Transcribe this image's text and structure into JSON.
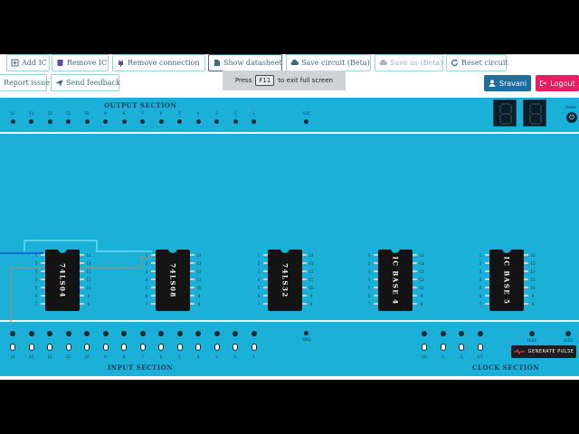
{
  "toolbar": {
    "add_ic": "Add IC",
    "remove_ic": "Remove IC",
    "remove_connection": "Remove connection",
    "show_datasheet": "Show datasheet",
    "save_circuit": "Save circuit (Beta)",
    "save_as": "Save as (Beta)",
    "reset_circuit": "Reset circuit",
    "report_issue": "Report issue",
    "send_feedback": "Send feedback"
  },
  "user": {
    "name": "Sravani",
    "logout": "Logout"
  },
  "toast": {
    "before": "Press",
    "key": "F11",
    "after": "to exit full screen"
  },
  "board": {
    "output_section": "OUTPUT SECTION",
    "input_section": "INPUT SECTION",
    "clock_section": "CLOCK SECTION",
    "power_label": "Power",
    "generate_pulse": "GENERATE PULSE",
    "vcc_label": "VCC",
    "gnd_label": "GND",
    "output_pins": [
      "14",
      "13",
      "12",
      "11",
      "10",
      "9",
      "8",
      "7",
      "6",
      "5",
      "4",
      "3",
      "2",
      "1"
    ],
    "input_pins": [
      "14",
      "13",
      "12",
      "11",
      "10",
      "9",
      "8",
      "7",
      "6",
      "5",
      "4",
      "3",
      "2",
      "1"
    ],
    "clock_pins": [
      "1H",
      "1",
      "1",
      "0.5"
    ],
    "clock_extra": [
      "LED1",
      "LED2"
    ],
    "chips": [
      "74LS04",
      "74LS08",
      "74LS32",
      "IC BASE 4",
      "IC BASE 5"
    ]
  },
  "colors": {
    "board": "#1ab0d7",
    "wire_cyan": "#7fe5ff",
    "wire_blue": "#0044cc",
    "wire_gray": "#9a8f72",
    "logout": "#e81e63",
    "user": "#1f6ea0"
  }
}
